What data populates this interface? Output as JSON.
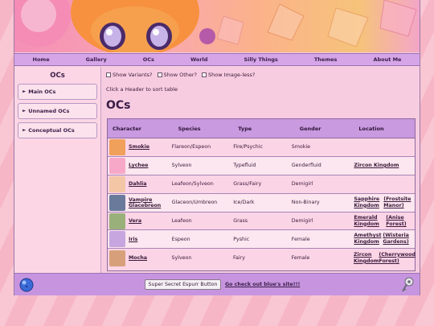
{
  "colors": {
    "nav_bg": "#d5a5e8",
    "header_row": "#c99ae0",
    "footer_bg": "#c795e0",
    "page_bg": "#f7cce0"
  },
  "nav": {
    "items": [
      "Home",
      "Gallery",
      "OCs",
      "World",
      "Silly Things",
      "Themes",
      "About Me"
    ]
  },
  "sidebar": {
    "title": "OCs",
    "items": [
      {
        "label": "Main OCs"
      },
      {
        "label": "Unnamed OCs"
      },
      {
        "label": "Conceptual OCs"
      }
    ]
  },
  "filters": {
    "variants": "Show Variants?",
    "other": "Show Other?",
    "imageless": "Show Image-less?"
  },
  "hint": "Click a Header to sort table",
  "heading": "OCs",
  "table": {
    "headers": [
      "Character",
      "Species",
      "Type",
      "Gender",
      "Location"
    ],
    "rows": [
      {
        "name": "Smokie",
        "species": "Flareon/Espeon",
        "type": "Fire/Psychic",
        "gender": "Smokie",
        "loc1": "",
        "loc2": "",
        "thumb": "#f0a05a"
      },
      {
        "name": "Lychee",
        "species": "Sylveon",
        "type": "Typefluid",
        "gender": "Genderfluid",
        "loc1": "Zircon Kingdom",
        "loc2": "",
        "thumb": "#f7a8c8"
      },
      {
        "name": "Dahlia",
        "species": "Leafeon/Sylveon",
        "type": "Grass/Fairy",
        "gender": "Demigirl",
        "loc1": "",
        "loc2": "",
        "thumb": "#f3c6a6"
      },
      {
        "name": "Vampire Glacebreon",
        "species": "Glaceon/Umbreon",
        "type": "Ice/Dark",
        "gender": "Non-Binary",
        "loc1": "Sapphire Kingdom",
        "loc2": "(Frostsite Manor)",
        "thumb": "#6a7a9a"
      },
      {
        "name": "Vera",
        "species": "Leafeon",
        "type": "Grass",
        "gender": "Demigirl",
        "loc1": "Emerald Kingdom",
        "loc2": "(Anise Forest)",
        "thumb": "#9ab07a"
      },
      {
        "name": "Iris",
        "species": "Espeon",
        "type": "Pyshic",
        "gender": "Female",
        "loc1": "Amethyst Kingdom",
        "loc2": "(Wisteria Gardens)",
        "thumb": "#c7a6e0"
      },
      {
        "name": "Mocha",
        "species": "Sylveon",
        "type": "Fairy",
        "gender": "Female",
        "loc1": "Zircon Kingdom",
        "loc2": "(Cherrywood Forest)",
        "thumb": "#d7a07a"
      }
    ]
  },
  "footer": {
    "button": "Super Secret Espurr Button",
    "link": "Go check out blue's site!!!"
  }
}
